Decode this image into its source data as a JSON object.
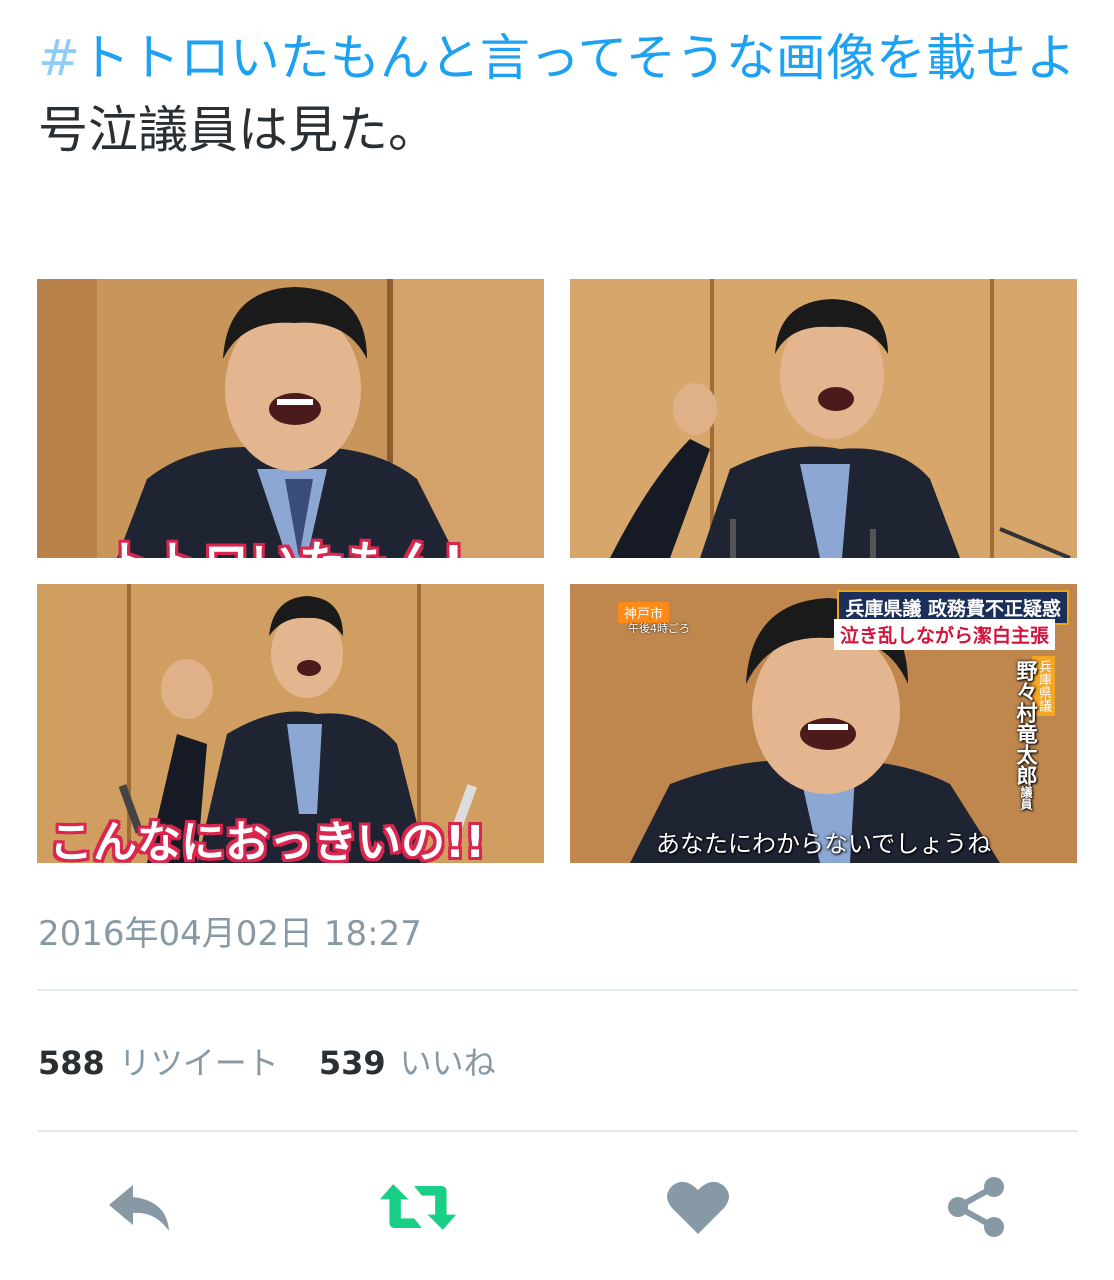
{
  "tweet": {
    "hash_sign": "#",
    "hashtag": "トトロいたもんと言ってそうな画像を載せよ",
    "body": "号泣議員は見た。"
  },
  "media": {
    "photo1_caption": "トトロいたもん!",
    "photo3_caption": "こんなにおっきいの!!",
    "photo4_caption": "あなたにわからないでしょうね",
    "photo4_news_title1": "兵庫県議 政務費不正疑惑",
    "photo4_news_title2": "泣き乱しながら潔白主張",
    "photo4_location": "神戸市",
    "photo4_location_time": "午後4時ごろ",
    "photo4_badge": "兵庫県議",
    "photo4_name": "野々村竜太郎",
    "photo4_name_suffix": "議員"
  },
  "timestamp": "2016年04月02日 18:27",
  "stats": {
    "retweets_count": "588",
    "retweets_label": "リツイート",
    "likes_count": "539",
    "likes_label": "いいね"
  },
  "actions": {
    "reply_icon": "reply-icon",
    "retweet_icon": "retweet-icon",
    "like_icon": "heart-icon",
    "share_icon": "share-icon"
  },
  "colors": {
    "hashtag": "#1da1f2",
    "muted": "#8899a6",
    "retweet_active": "#19cf86",
    "icon_gray": "#8899a6",
    "divider": "#e1e8ed"
  }
}
